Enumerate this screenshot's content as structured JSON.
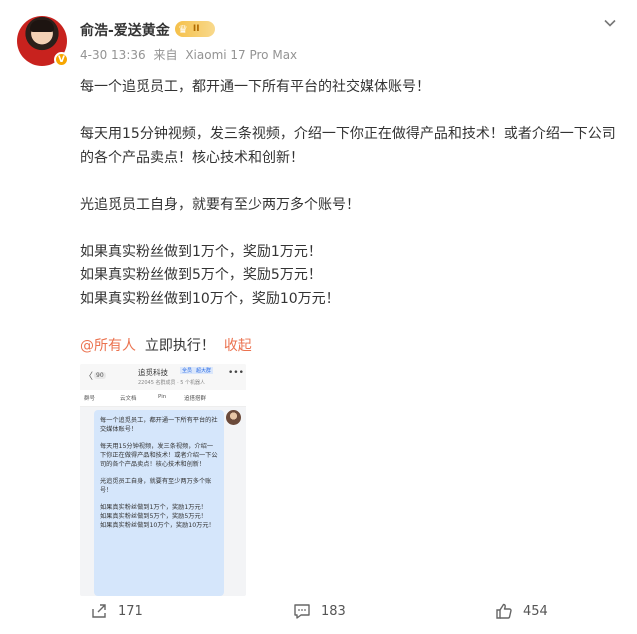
{
  "post": {
    "username": "俞浩-爱送黄金",
    "level_badge": "II",
    "time": "4-30 13:36",
    "source_prefix": "来自",
    "source_device": "Xiaomi 17 Pro Max",
    "paragraphs": [
      "每一个追觅员工，都开通一下所有平台的社交媒体账号！",
      "每天用15分钟视频，发三条视频，介绍一下你正在做得产品和技术！或者介绍一下公司的各个产品卖点！核心技术和创新！",
      "光追觅员工自身，就要有至少两万多个账号！",
      "如果真实粉丝做到1万个，奖励1万元！",
      "如果真实粉丝做到5万个，奖励5万元！",
      "如果真实粉丝做到10万个，奖励10万元！"
    ],
    "mention": "@所有人",
    "tail_text": "立即执行！",
    "collapse_label": "收起"
  },
  "screenshot_thumbnail": {
    "back_label": "〈",
    "unread_count": "90",
    "group_title": "追觅科技",
    "tag1": "全员",
    "tag2": "超大群",
    "group_subtitle": "22045 名群成员 · 5 个机器人",
    "more_label": "•••",
    "tabs": [
      "群号",
      "云文档",
      "Pin",
      "追搭搭群"
    ],
    "bubble_lines": [
      "每一个追觅员工，都开通一下所有平台的社交媒体账号！",
      "",
      "每天用15分钟视频，发三条视频，介绍一下你正在做得产品和技术！或者介绍一下公司的各个产品卖点！核心技术和创新！",
      "",
      "光追觅员工自身，就要有至少两万多个账号！",
      "",
      "如果真实粉丝做到1万个，奖励1万元！",
      "如果真实粉丝做到5万个，奖励5万元！",
      "如果真实粉丝做到10万个，奖励10万元！"
    ]
  },
  "actions": {
    "repost_count": "171",
    "comment_count": "183",
    "like_count": "454"
  },
  "icons": {
    "menu": "chevron-down-icon",
    "repost": "share-icon",
    "comment": "comment-icon",
    "like": "thumbs-up-icon",
    "verify": "verified-badge-icon",
    "crown": "crown-icon"
  },
  "colors": {
    "link": "#eb7350",
    "meta": "#939393",
    "text": "#333333",
    "bubble": "#d5e6fb",
    "badge": "#f7a600"
  }
}
